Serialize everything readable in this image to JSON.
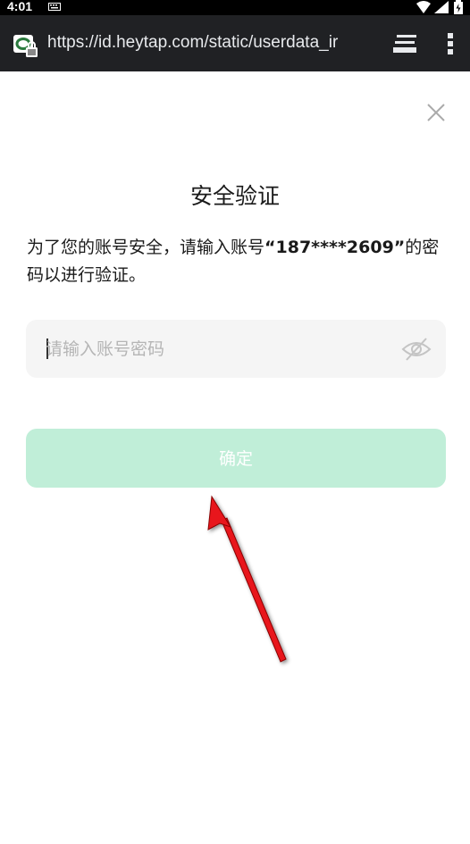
{
  "status_bar": {
    "time": "4:01"
  },
  "browser": {
    "url": "https://id.heytap.com/static/userdata_ir"
  },
  "dialog": {
    "title": "安全验证",
    "description_prefix": "为了您的账号安全，请输入账号",
    "account": "“187****2609”",
    "description_suffix": "的密码以进行验证。",
    "password_placeholder": "请输入账号密码",
    "password_value": "",
    "confirm_label": "确定",
    "confirm_enabled": false
  },
  "colors": {
    "confirm_disabled_bg": "#c0eed8",
    "input_bg": "#f5f5f5",
    "annotation_arrow": "#e8161b"
  },
  "icons": {
    "close": "close-icon",
    "password_toggle": "eye-off-icon",
    "site": "lock-site-icon",
    "tabs": "tabs-icon",
    "menu": "more-vert-icon"
  }
}
